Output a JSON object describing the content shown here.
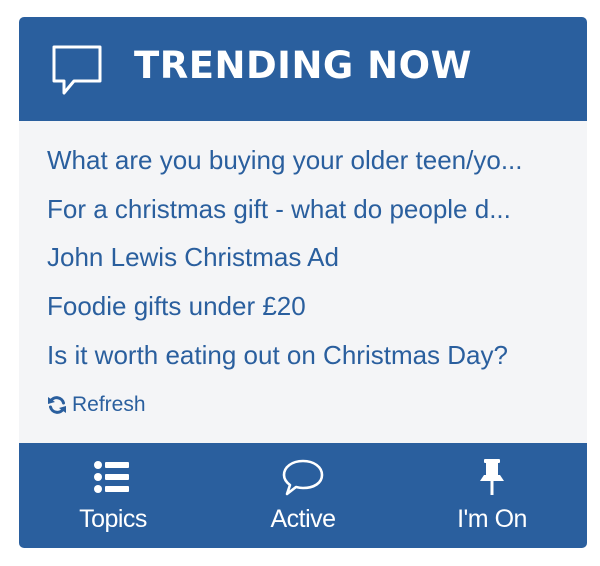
{
  "header": {
    "title": "TRENDING NOW",
    "icon": "chat-bubble-icon"
  },
  "trending": {
    "items": [
      "What are you buying your older teen/yo...",
      "For a christmas gift - what do people d...",
      "John Lewis Christmas Ad",
      "Foodie gifts under £20",
      "Is it worth eating out on Christmas Day?"
    ],
    "refresh_label": "Refresh",
    "refresh_icon": "refresh-icon"
  },
  "footer": {
    "nav": [
      {
        "label": "Topics",
        "icon": "list-icon"
      },
      {
        "label": "Active",
        "icon": "speech-bubble-icon"
      },
      {
        "label": "I'm On",
        "icon": "pin-icon"
      }
    ]
  },
  "colors": {
    "brand_blue": "#2a5f9e",
    "panel_bg": "#f4f5f7",
    "header_text": "#ffffff"
  }
}
